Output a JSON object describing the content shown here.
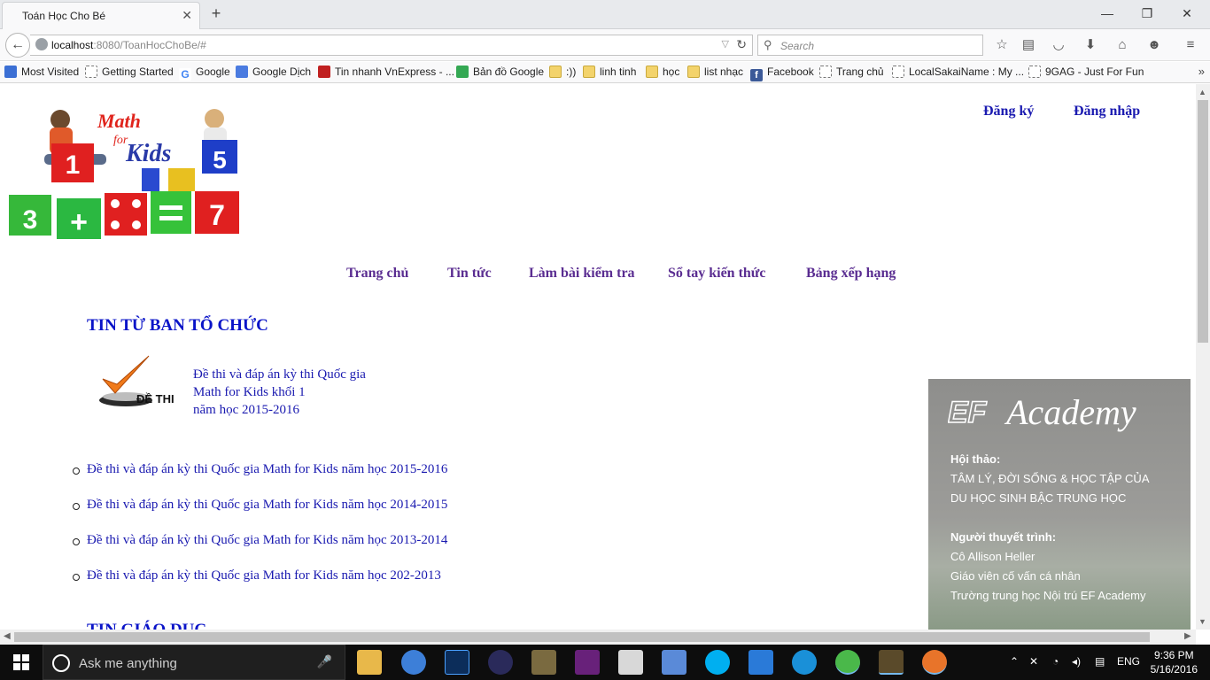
{
  "browser": {
    "tab_title": "Toán Học Cho Bé",
    "url_host": "localhost",
    "url_path": ":8080/ToanHocChoBe/#",
    "search_placeholder": "Search"
  },
  "bookmarks": [
    {
      "label": "Most Visited",
      "icon": "bookmark-icon"
    },
    {
      "label": "Getting Started",
      "icon": "page-icon"
    },
    {
      "label": "Google",
      "icon": "google-icon"
    },
    {
      "label": "Google Dịch",
      "icon": "translate-icon"
    },
    {
      "label": "Tin nhanh VnExpress - ...",
      "icon": "news-icon"
    },
    {
      "label": "Bản đồ Google",
      "icon": "maps-icon"
    },
    {
      "label": ":))",
      "icon": "folder-icon"
    },
    {
      "label": "linh tinh",
      "icon": "folder-icon"
    },
    {
      "label": "học",
      "icon": "folder-icon"
    },
    {
      "label": "list nhạc",
      "icon": "folder-icon"
    },
    {
      "label": "Facebook",
      "icon": "facebook-icon"
    },
    {
      "label": "Trang chủ",
      "icon": "page-icon"
    },
    {
      "label": "LocalSakaiName : My ...",
      "icon": "page-icon"
    },
    {
      "label": "9GAG - Just For Fun",
      "icon": "page-icon"
    }
  ],
  "site": {
    "logo_text": {
      "math": "Math",
      "for": "for",
      "kids": "Kids"
    },
    "auth": {
      "register": "Đăng ký",
      "login": "Đăng nhập"
    },
    "menu": [
      "Trang chủ",
      "Tin tức",
      "Làm bài kiểm tra",
      "Sổ tay kiến thức",
      "Bảng xếp hạng"
    ],
    "section1_title": "TIN TỪ BAN TỔ CHỨC",
    "exam_icon_label": "ĐỀ THI",
    "feature": {
      "line1": "Đề thi và đáp án kỳ thi Quốc gia",
      "line2": "Math for Kids khối 1",
      "line3": "năm học 2015-2016"
    },
    "news": [
      "Đề thi và đáp án kỳ thi Quốc gia Math for Kids năm học 2015-2016",
      "Đề thi và đáp án kỳ thi Quốc gia Math for Kids năm học 2014-2015",
      "Đề thi và đáp án kỳ thi Quốc gia Math for Kids năm học 2013-2014",
      "Đề thi và đáp án kỳ thi Quốc gia Math for Kids năm học 202-2013"
    ],
    "section2_title": "TIN GIÁO DỤC"
  },
  "ad": {
    "brand_ef": "EF",
    "brand": "Academy",
    "event_heading": "Hội thảo:",
    "event_line1": "TÂM LÝ, ĐỜI SỐNG & HỌC TẬP CỦA",
    "event_line2": "DU HỌC SINH BẬC TRUNG HỌC",
    "presenter_heading": "Người thuyết trình:",
    "presenter_line1": "Cô Allison Heller",
    "presenter_line2": "Giáo viên cố vấn cá nhân",
    "presenter_line3": "Trường trung học Nội trú EF Academy"
  },
  "taskbar": {
    "search_placeholder": "Ask me anything",
    "language": "ENG",
    "time": "9:36 PM",
    "date": "5/16/2016"
  },
  "colors": {
    "link_blue": "#1a1ab0",
    "menu_purple": "#5a2d91",
    "section_blue": "#0a14c8"
  }
}
